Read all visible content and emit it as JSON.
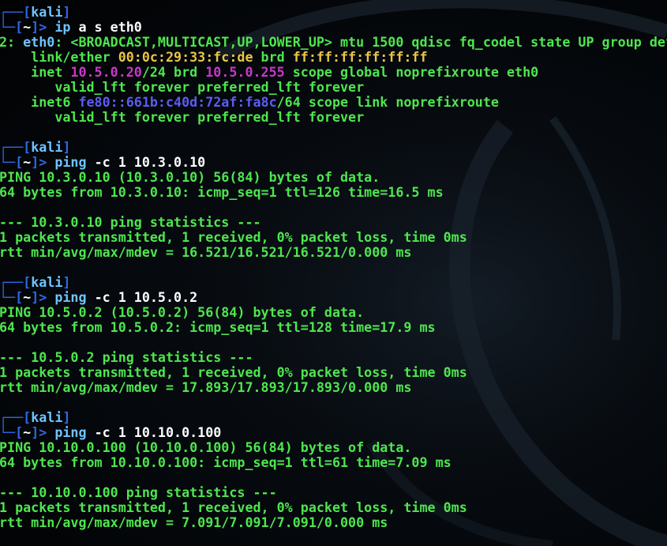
{
  "prompt": {
    "user": "kali",
    "dir": "~"
  },
  "blocks": [
    {
      "command": {
        "name": "ip",
        "args": "a s eth0"
      },
      "output": {
        "line1_prefix": "2: ",
        "iface": "eth0",
        "line1_rest": ": <BROADCAST,MULTICAST,UP,LOWER_UP> mtu 1500 qdisc fq_codel state UP group def",
        "link_prefix": "    link/ether ",
        "mac": "00:0c:29:33:fc:de",
        "link_mid": " brd ",
        "mac_brd": "ff:ff:ff:ff:ff:ff",
        "inet_prefix": "    inet ",
        "inet_addr": "10.5.0.20",
        "inet_mid": "/24 brd ",
        "inet_brd": "10.5.0.255",
        "inet_rest": " scope global noprefixroute eth0",
        "valid1": "       valid_lft forever preferred_lft forever",
        "inet6_prefix": "    inet6 ",
        "inet6_addr": "fe80::661b:c40d:72af:fa8c",
        "inet6_rest": "/64 scope link noprefixroute",
        "valid2": "       valid_lft forever preferred_lft forever"
      }
    },
    {
      "command": {
        "name": "ping",
        "args": "-c 1 10.3.0.10"
      },
      "output": [
        "PING 10.3.0.10 (10.3.0.10) 56(84) bytes of data.",
        "64 bytes from 10.3.0.10: icmp_seq=1 ttl=126 time=16.5 ms",
        "",
        "--- 10.3.0.10 ping statistics ---",
        "1 packets transmitted, 1 received, 0% packet loss, time 0ms",
        "rtt min/avg/max/mdev = 16.521/16.521/16.521/0.000 ms"
      ]
    },
    {
      "command": {
        "name": "ping",
        "args": "-c 1 10.5.0.2"
      },
      "output": [
        "PING 10.5.0.2 (10.5.0.2) 56(84) bytes of data.",
        "64 bytes from 10.5.0.2: icmp_seq=1 ttl=128 time=17.9 ms",
        "",
        "--- 10.5.0.2 ping statistics ---",
        "1 packets transmitted, 1 received, 0% packet loss, time 0ms",
        "rtt min/avg/max/mdev = 17.893/17.893/17.893/0.000 ms"
      ]
    },
    {
      "command": {
        "name": "ping",
        "args": "-c 1 10.10.0.100"
      },
      "output": [
        "PING 10.10.0.100 (10.10.0.100) 56(84) bytes of data.",
        "64 bytes from 10.10.0.100: icmp_seq=1 ttl=61 time=7.09 ms",
        "",
        "--- 10.10.0.100 ping statistics ---",
        "1 packets transmitted, 1 received, 0% packet loss, time 0ms",
        "rtt min/avg/max/mdev = 7.091/7.091/7.091/0.000 ms"
      ]
    }
  ],
  "colors": {
    "text": "#4ee64e",
    "bracket": "#2f67e6",
    "host": "#6ec4ff",
    "command": "#6ec4ff",
    "mac": "#e8c547",
    "ipv4": "#c838c8",
    "ipv6": "#5c5cf0",
    "background": "#05080c"
  }
}
